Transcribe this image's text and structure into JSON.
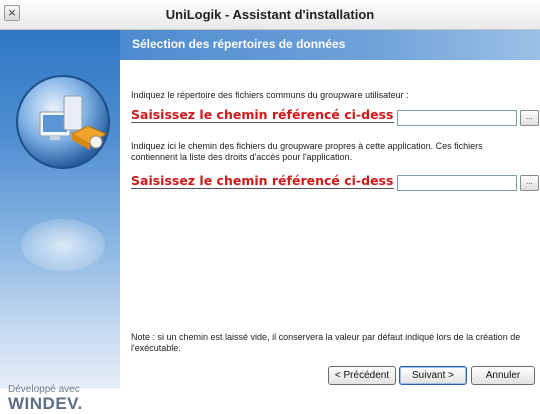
{
  "window": {
    "title": "UniLogik - Assistant d'installation",
    "close_glyph": "×"
  },
  "header": {
    "title": "Sélection des répertoires de données"
  },
  "fields": [
    {
      "label": "Indiquez le répertoire des fichiers communs du groupware utilisateur :",
      "value": "Saisissez le chemin référencé ci-dessus",
      "browse_label": "..."
    },
    {
      "label": "Indiquez ici le chemin des fichiers du groupware propres à cette application. Ces fichiers contiennent la liste des droits d'accès pour l'application.",
      "value": "Saisissez le chemin référencé ci-dessus",
      "browse_label": "..."
    }
  ],
  "note": "Note : si un chemin est laissé vide, il conservera la valeur par défaut indiqué lors de la création de l'exécutable.",
  "buttons": {
    "previous": "< Précédent",
    "next": "Suivant >",
    "cancel": "Annuler"
  },
  "branding": {
    "line1": "Développé avec",
    "line2": "WINDEV."
  },
  "colors": {
    "field_text": "#d01818",
    "header_blue": "#4d8bcf"
  }
}
